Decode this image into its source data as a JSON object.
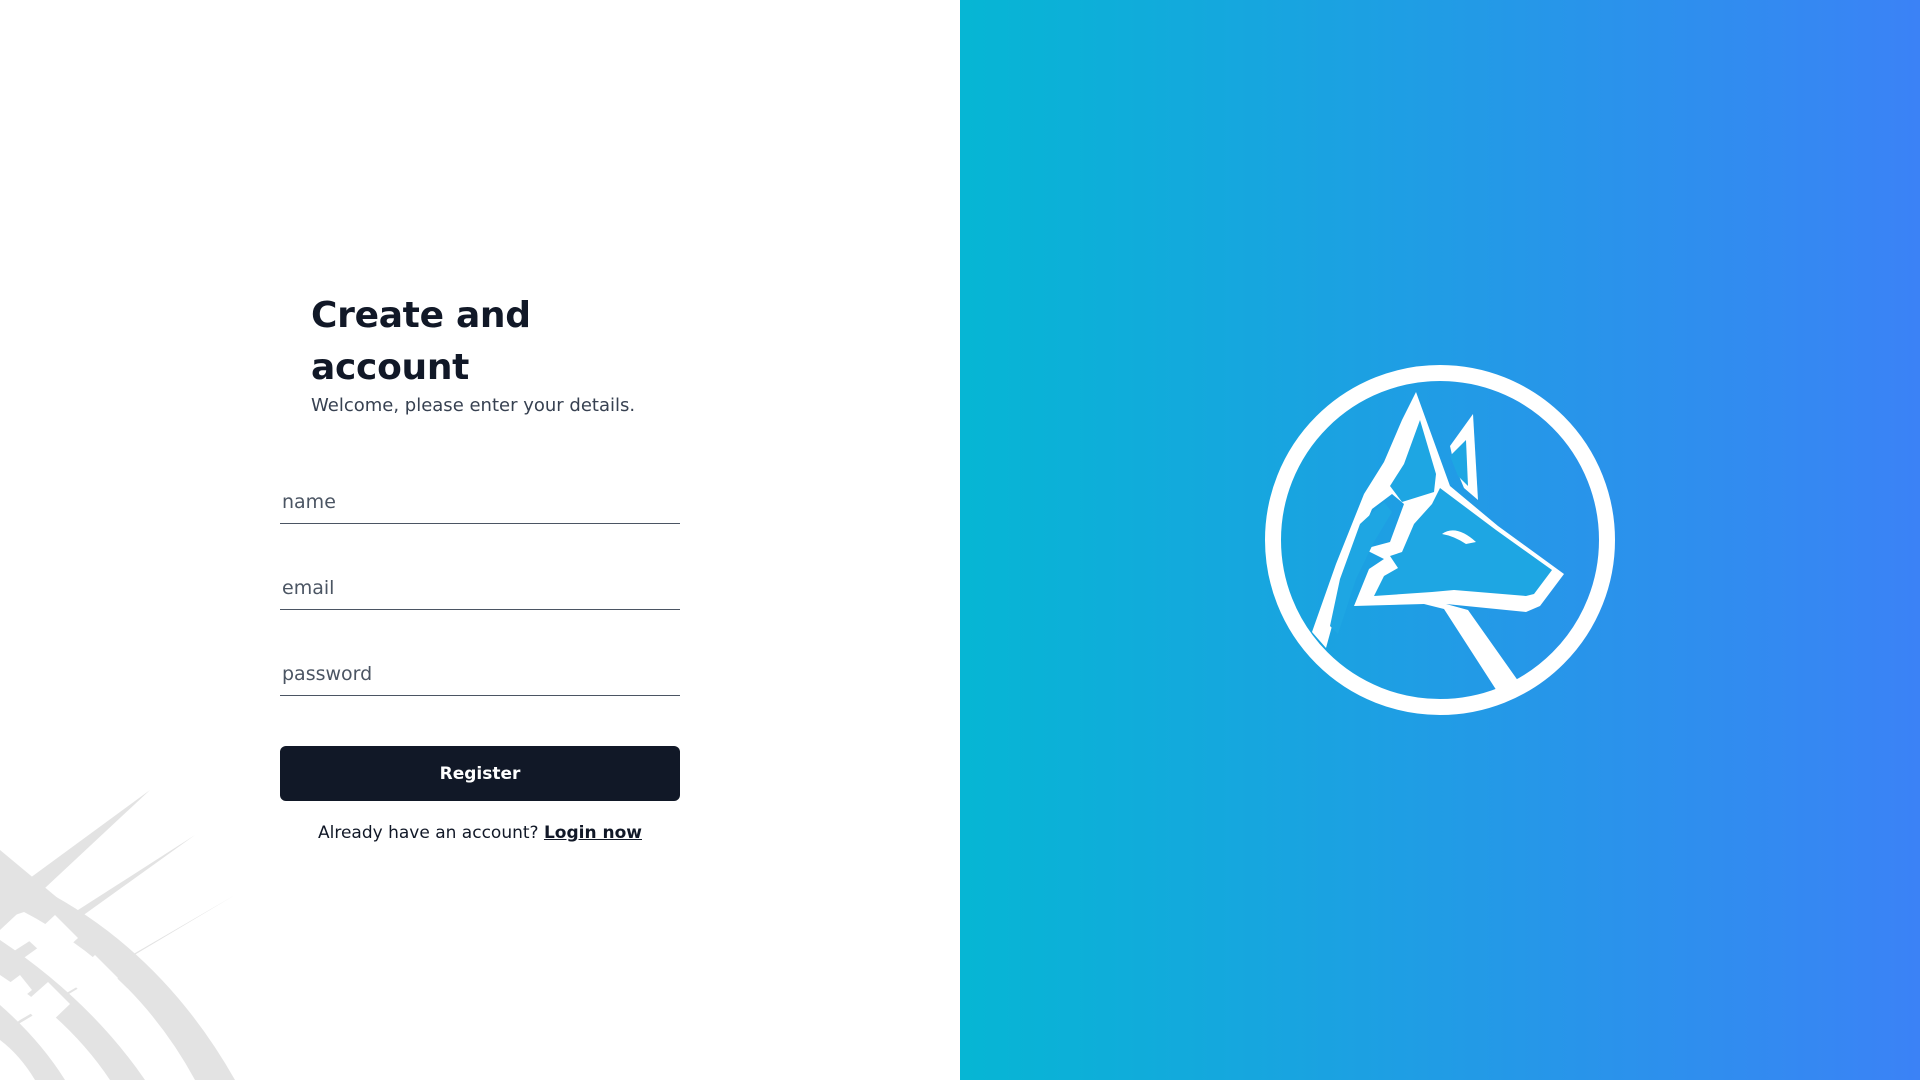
{
  "form": {
    "heading": "Create and account",
    "subheading": "Welcome, please enter your details.",
    "name_placeholder": "name",
    "email_placeholder": "email",
    "password_placeholder": "password",
    "register_label": "Register",
    "login_prompt": "Already have an account?",
    "login_link": "Login now"
  },
  "colors": {
    "primary_dark": "#111827",
    "gradient_start": "#06b6d4",
    "gradient_end": "#3b82f6",
    "decor_gray": "#e5e7eb"
  },
  "icons": {
    "logo": "fox-logo-icon",
    "decor": "crosshatch-decor"
  }
}
